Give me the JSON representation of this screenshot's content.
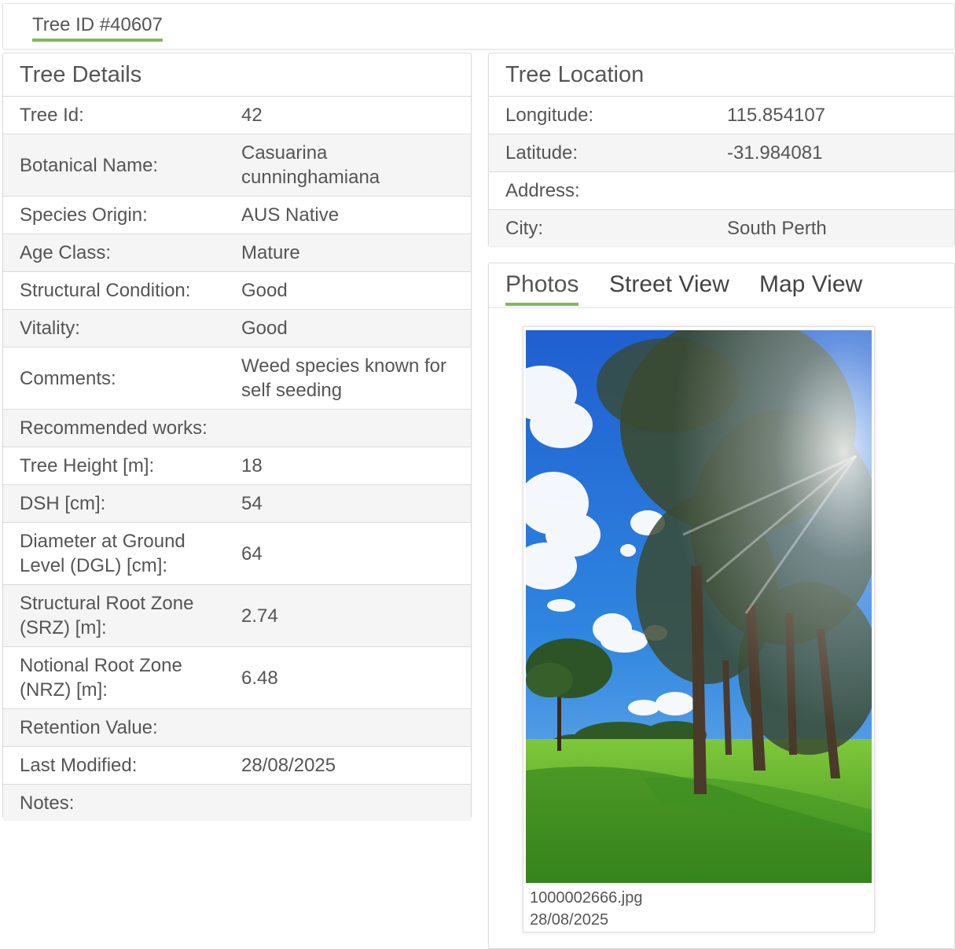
{
  "header": {
    "tab_label": "Tree ID #40607"
  },
  "details": {
    "title": "Tree Details",
    "rows": [
      {
        "label": "Tree Id:",
        "value": "42"
      },
      {
        "label": "Botanical Name:",
        "value": "Casuarina cunninghamiana"
      },
      {
        "label": "Species Origin:",
        "value": "AUS Native"
      },
      {
        "label": "Age Class:",
        "value": "Mature"
      },
      {
        "label": "Structural Condition:",
        "value": "Good"
      },
      {
        "label": "Vitality:",
        "value": "Good"
      },
      {
        "label": "Comments:",
        "value": "Weed species known for self seeding"
      },
      {
        "label": "Recommended works:",
        "value": ""
      },
      {
        "label": "Tree Height [m]:",
        "value": "18"
      },
      {
        "label": "DSH [cm]:",
        "value": "54"
      },
      {
        "label": "Diameter at Ground Level (DGL) [cm]:",
        "value": "64"
      },
      {
        "label": "Structural Root Zone (SRZ) [m]:",
        "value": "2.74"
      },
      {
        "label": "Notional Root Zone (NRZ) [m]:",
        "value": "6.48"
      },
      {
        "label": "Retention Value:",
        "value": ""
      },
      {
        "label": "Last Modified:",
        "value": "28/08/2025"
      },
      {
        "label": "Notes:",
        "value": ""
      }
    ]
  },
  "location": {
    "title": "Tree Location",
    "rows": [
      {
        "label": "Longitude:",
        "value": "115.854107"
      },
      {
        "label": "Latitude:",
        "value": "-31.984081"
      },
      {
        "label": "Address:",
        "value": ""
      },
      {
        "label": "City:",
        "value": "South Perth"
      }
    ]
  },
  "media": {
    "tabs": [
      {
        "label": "Photos",
        "active": true
      },
      {
        "label": "Street View",
        "active": false
      },
      {
        "label": "Map View",
        "active": false
      }
    ],
    "photo": {
      "filename": "1000002666.jpg",
      "date": "28/08/2025"
    }
  },
  "colors": {
    "accent": "#7fba59",
    "row_alt": "#f5f5f5",
    "border": "#dcdcdc"
  }
}
